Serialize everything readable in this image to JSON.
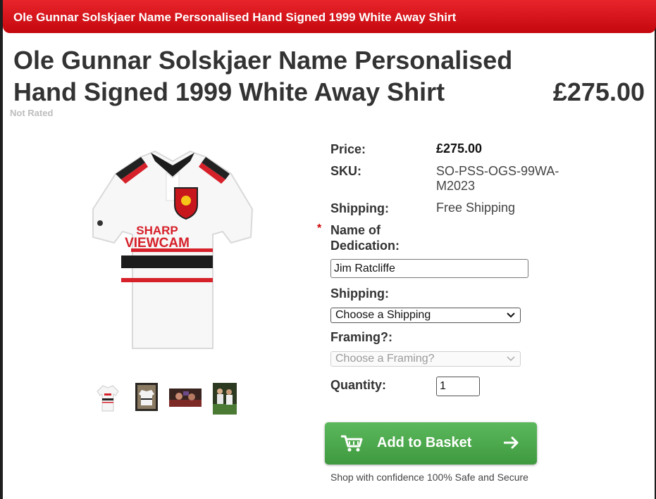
{
  "banner": {
    "title": "Ole Gunnar Solskjaer Name Personalised Hand Signed 1999 White Away Shirt"
  },
  "product": {
    "title": "Ole Gunnar Solskjaer Name Personalised Hand Signed 1999 White Away Shirt",
    "price_display": "£275.00",
    "rating_text": "Not Rated",
    "image_alt": "White away shirt with SHARP VIEWCAM sponsor",
    "thumbnails": [
      "shirt-front",
      "framed-shirt",
      "signing-photo",
      "players-photo"
    ]
  },
  "details": {
    "price_label": "Price:",
    "price_value": "£275.00",
    "sku_label": "SKU:",
    "sku_value_line1": "SO-PSS-OGS-99WA-",
    "sku_value_line2": "M2023",
    "shipping_label": "Shipping:",
    "shipping_value": "Free Shipping",
    "dedication_label_line1": "Name of",
    "dedication_label_line2": "Dedication:",
    "required_mark": "*",
    "dedication_value": "Jim Ratcliffe",
    "shipping_select_label": "Shipping:",
    "shipping_select_value": "Choose a Shipping",
    "framing_label": "Framing?:",
    "framing_select_value": "Choose a Framing?",
    "quantity_label": "Quantity:",
    "quantity_value": "1"
  },
  "cta": {
    "add_to_basket": "Add to Basket",
    "confidence_text": "Shop with confidence 100% Safe and Secure"
  },
  "colors": {
    "banner_red": "#d4121a",
    "button_green": "#4cae4c",
    "required_red": "#cc0000",
    "text_dark": "#333333"
  }
}
